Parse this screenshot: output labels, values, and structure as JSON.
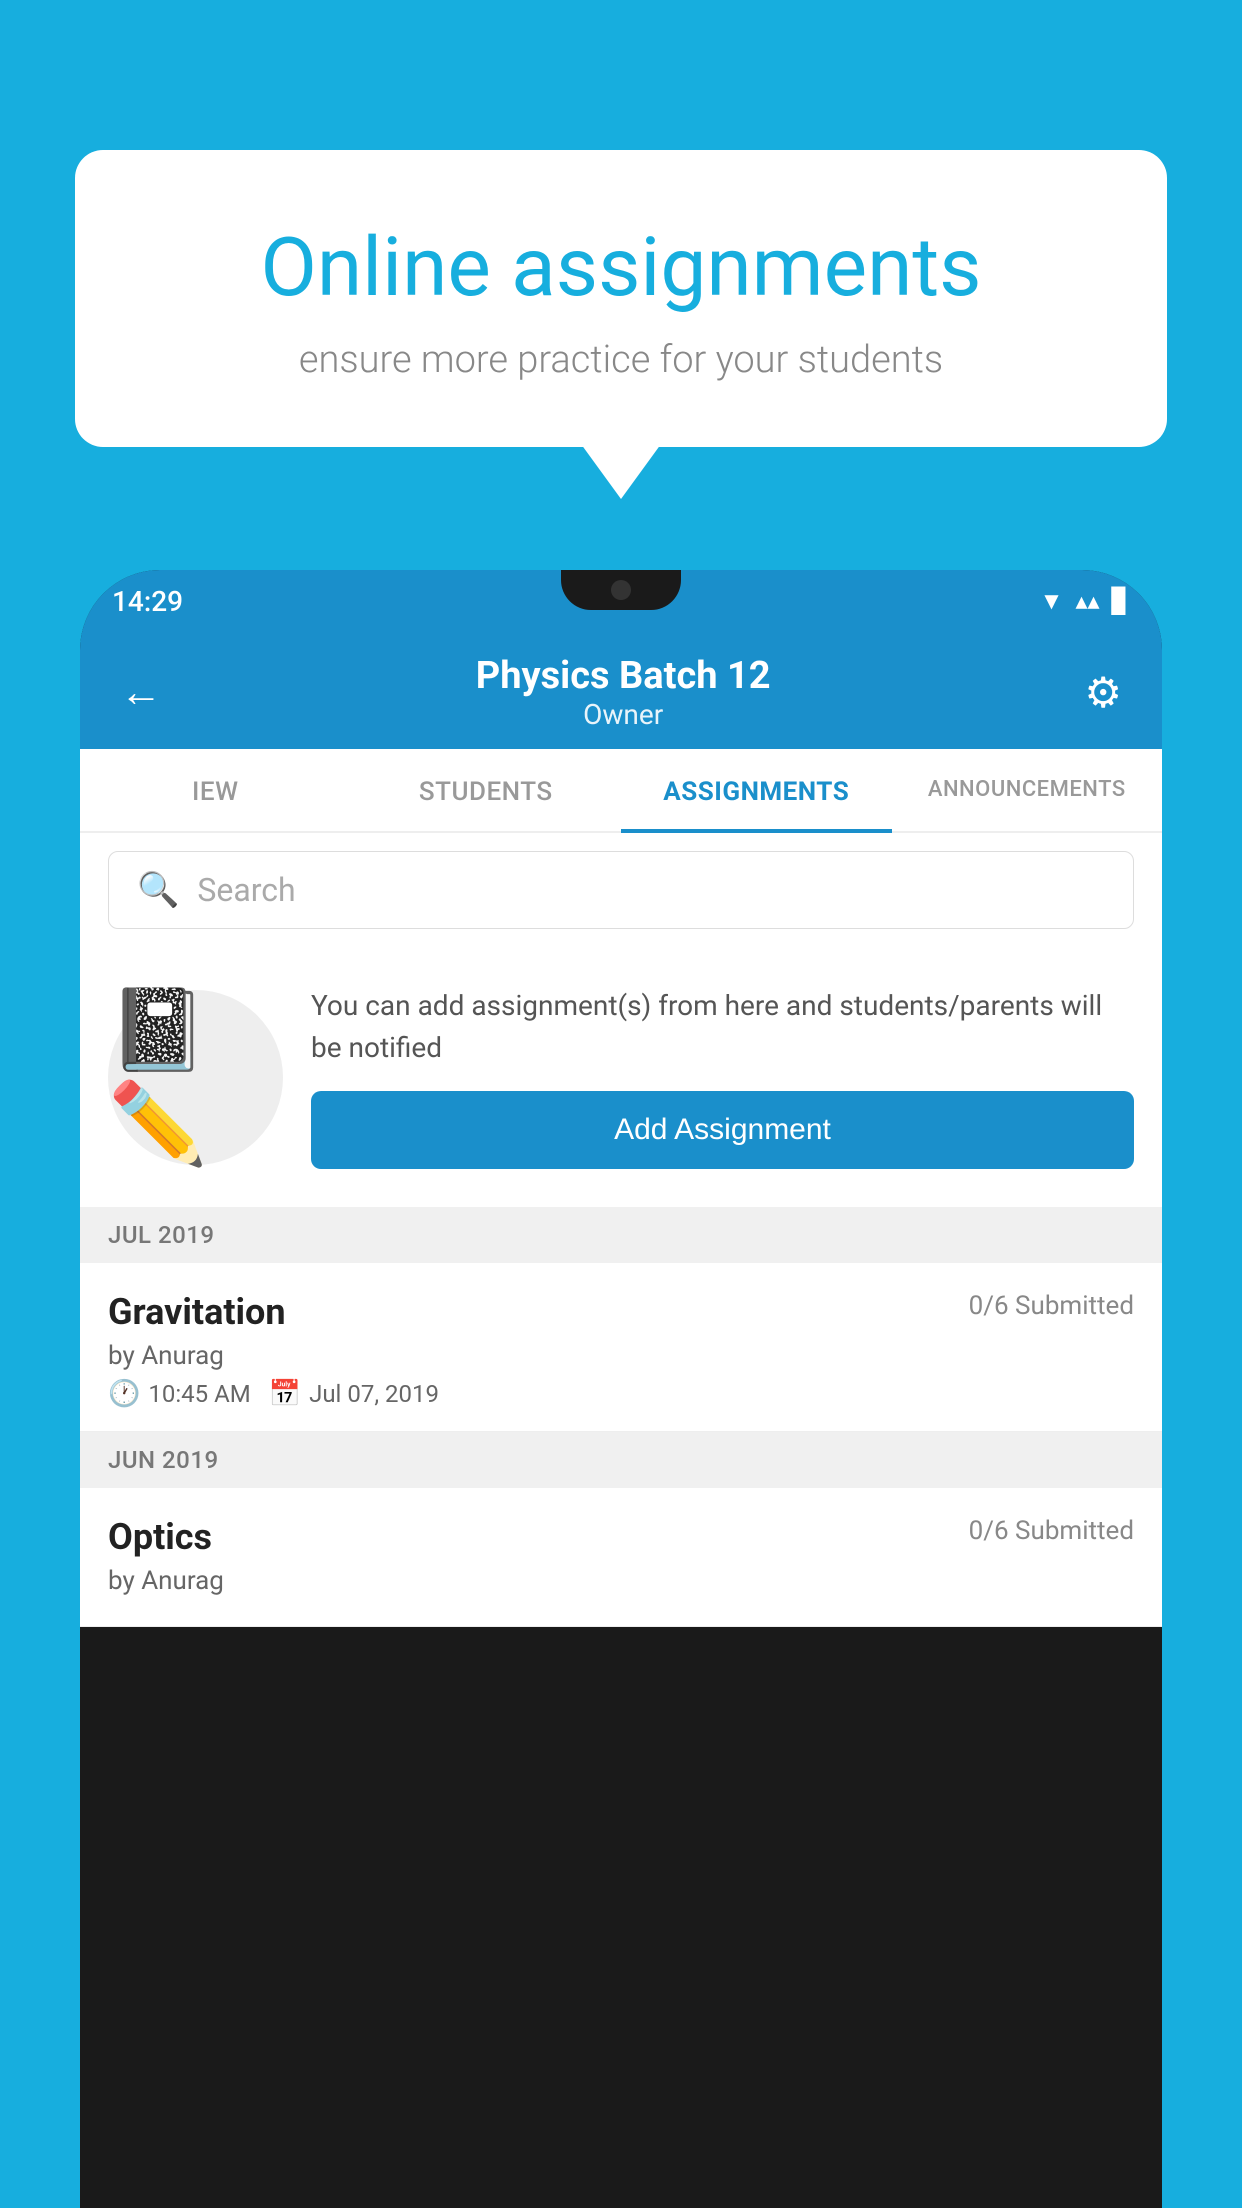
{
  "background_color": "#17AEDE",
  "speech_bubble": {
    "heading": "Online assignments",
    "subtext": "ensure more practice for your students"
  },
  "phone": {
    "status_bar": {
      "time": "14:29",
      "wifi_icon": "▲",
      "signal_icon": "▲",
      "battery_icon": "▊"
    },
    "header": {
      "title": "Physics Batch 12",
      "subtitle": "Owner",
      "back_label": "←",
      "settings_label": "⚙"
    },
    "tabs": [
      {
        "label": "IEW",
        "active": false
      },
      {
        "label": "STUDENTS",
        "active": false
      },
      {
        "label": "ASSIGNMENTS",
        "active": true
      },
      {
        "label": "ANNOUNCEMENTS",
        "active": false
      }
    ],
    "search": {
      "placeholder": "Search"
    },
    "promo": {
      "description": "You can add assignment(s) from here and students/parents will be notified",
      "button_label": "Add Assignment"
    },
    "assignment_sections": [
      {
        "month_label": "JUL 2019",
        "assignments": [
          {
            "title": "Gravitation",
            "submitted": "0/6 Submitted",
            "author": "by Anurag",
            "time": "10:45 AM",
            "date": "Jul 07, 2019"
          }
        ]
      },
      {
        "month_label": "JUN 2019",
        "assignments": [
          {
            "title": "Optics",
            "submitted": "0/6 Submitted",
            "author": "by Anurag",
            "time": "",
            "date": ""
          }
        ]
      }
    ]
  }
}
